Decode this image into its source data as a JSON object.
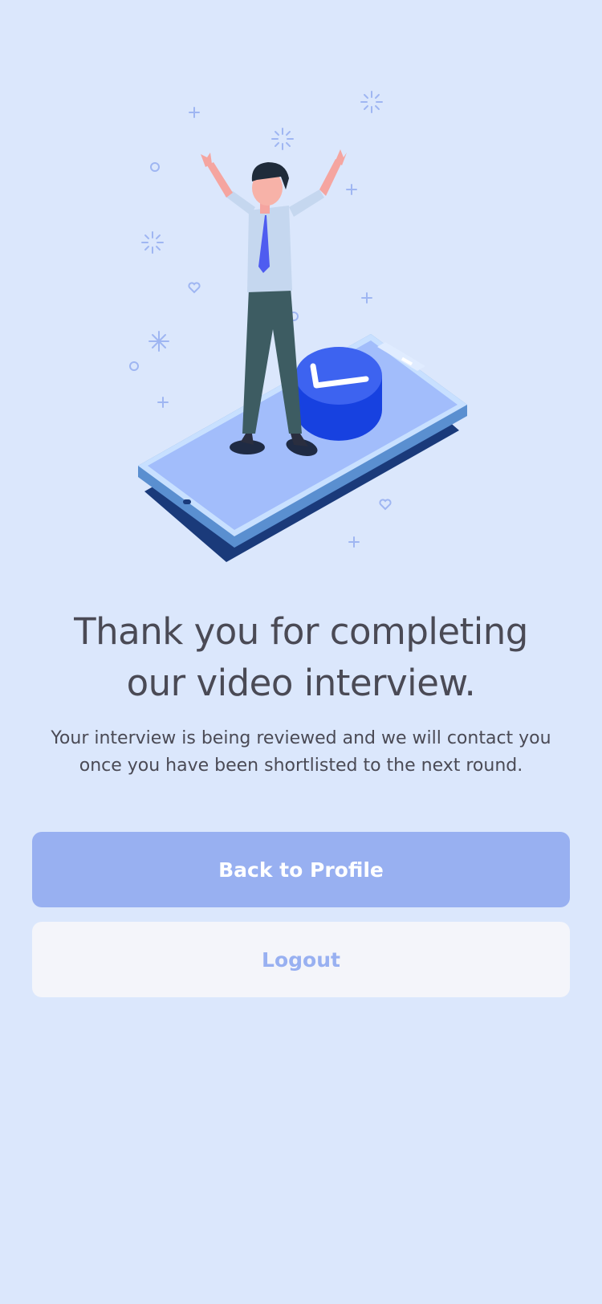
{
  "message": {
    "title_line1": "Thank you for completing",
    "title_line2": "our video interview.",
    "body_line1": "Your interview is being reviewed and we will contact you",
    "body_line2": "once you have been shortlisted to the next round."
  },
  "actions": {
    "primary_label": "Back to Profile",
    "secondary_label": "Logout"
  },
  "colors": {
    "background": "#dbe7fc",
    "primary_button": "#98b0f1",
    "secondary_button": "#f4f5fa",
    "text": "#4a4a55"
  },
  "illustration": {
    "subject": "celebrating-man-on-phone-with-checkmark"
  }
}
